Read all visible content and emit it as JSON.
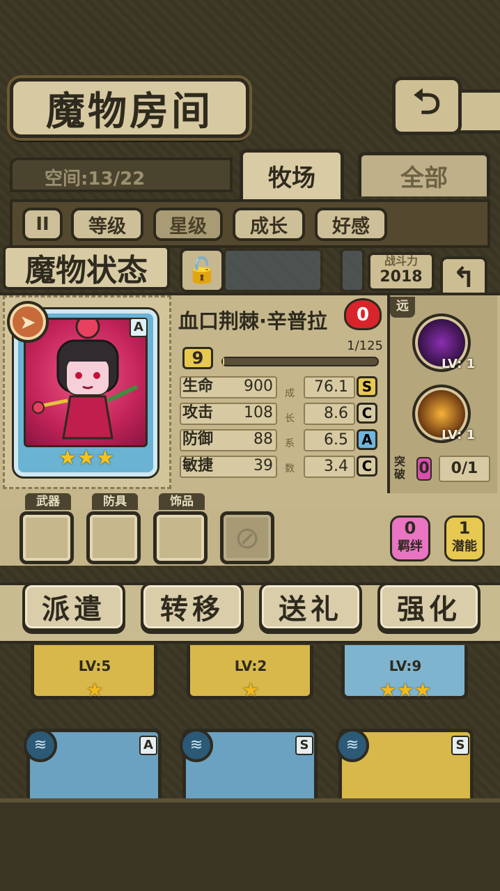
{
  "header": {
    "title": "魔物房间",
    "back_icon": "return-icon"
  },
  "tabs": {
    "space": "空间:13/22",
    "items": [
      {
        "label": "牧场",
        "active": true
      },
      {
        "label": "全部",
        "active": false
      }
    ]
  },
  "sort": {
    "pause_symbol": "II",
    "buttons": [
      "等级",
      "星级",
      "成长",
      "好感"
    ],
    "active_index": 1
  },
  "status": {
    "label": "魔物状态",
    "power_label": "战斗力",
    "power_value": "2018"
  },
  "monster": {
    "name": "血口荆棘·辛普拉",
    "affection": "0",
    "grade": "A",
    "stars": 3,
    "star_text": "★★★",
    "level": "9",
    "exp_text": "1/125",
    "exp_fraction": 0.008,
    "stats": [
      {
        "name": "生命",
        "value": "900",
        "growth": "76.1",
        "rank": "S"
      },
      {
        "name": "攻击",
        "value": "108",
        "growth": "8.6",
        "rank": "C"
      },
      {
        "name": "防御",
        "value": "88",
        "growth": "6.5",
        "rank": "A"
      },
      {
        "name": "敏捷",
        "value": "39",
        "growth": "3.4",
        "rank": "C"
      }
    ],
    "growth_chars": [
      "成",
      "长",
      "系",
      "数"
    ]
  },
  "skills": {
    "range": "远",
    "items": [
      {
        "level": "LV: 1"
      },
      {
        "level": "LV: 1"
      }
    ],
    "break_label": "突破",
    "break_count": "0",
    "break_progress": "0/1"
  },
  "equipment": {
    "slots": [
      "武器",
      "防具",
      "饰品"
    ],
    "bond": {
      "count": "0",
      "label": "羁绊"
    },
    "potential": {
      "count": "1",
      "label": "潜能"
    }
  },
  "actions": [
    "派遣",
    "转移",
    "送礼",
    "强化"
  ],
  "list_row1": [
    {
      "level": "LV:5",
      "stars": "★"
    },
    {
      "level": "LV:2",
      "stars": "★"
    },
    {
      "level": "LV:9",
      "stars": "★★★"
    }
  ],
  "list_row2": [
    {
      "grade": "A"
    },
    {
      "grade": "S"
    },
    {
      "grade": "S"
    }
  ],
  "colors": {
    "panel": "#c5b68c",
    "frame": "#2e2a1e",
    "rank_S": "#e7c850",
    "rank_A": "#6fb6de",
    "rank_C": "#d7caa2"
  }
}
